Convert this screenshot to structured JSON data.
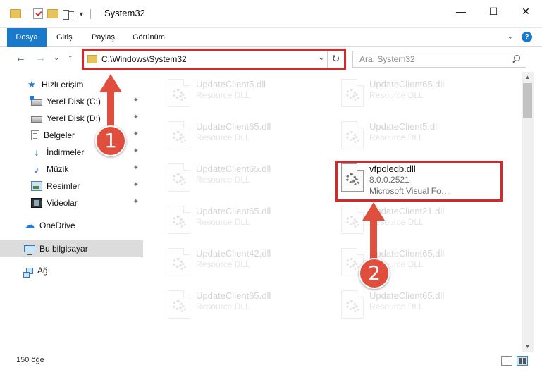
{
  "window": {
    "title": "System32",
    "controls": {
      "minimize": "—",
      "maximize": "☐",
      "close": "✕"
    }
  },
  "ribbon": {
    "tabs": [
      "Dosya",
      "Giriş",
      "Paylaş",
      "Görünüm"
    ],
    "expand": "⌄",
    "help": "?"
  },
  "nav": {
    "back": "←",
    "forward": "→",
    "recent": "⌄",
    "up": "↑",
    "address": "C:\\Windows\\System32",
    "address_dropdown": "⌄",
    "refresh": "↻",
    "search_placeholder": "Ara: System32"
  },
  "sidebar": {
    "items": [
      {
        "label": "Hızlı erişim",
        "icon": "star-icon",
        "pinned": false
      },
      {
        "label": "Yerel Disk (C:)",
        "icon": "drive-icon",
        "pinned": true
      },
      {
        "label": "Yerel Disk (D:)",
        "icon": "drive-icon",
        "pinned": true
      },
      {
        "label": "Belgeler",
        "icon": "documents-icon",
        "pinned": true
      },
      {
        "label": "İndirmeler",
        "icon": "download-icon",
        "pinned": true
      },
      {
        "label": "Müzik",
        "icon": "music-icon",
        "pinned": true
      },
      {
        "label": "Resimler",
        "icon": "pictures-icon",
        "pinned": true
      },
      {
        "label": "Videolar",
        "icon": "videos-icon",
        "pinned": true
      },
      {
        "label": "OneDrive",
        "icon": "cloud-icon",
        "pinned": false
      },
      {
        "label": "Bu bilgisayar",
        "icon": "computer-icon",
        "pinned": false,
        "selected": true
      },
      {
        "label": "Ağ",
        "icon": "network-icon",
        "pinned": false
      }
    ],
    "pin_glyph": "📌"
  },
  "files": [
    {
      "name": "UpdateClient5.dll",
      "type": "Resource DLL",
      "faded": true
    },
    {
      "name": "UpdateClient65.dll",
      "type": "Resource DLL",
      "faded": true
    },
    {
      "name": "UpdateClient65.dll",
      "type": "Resource DLL",
      "faded": true
    },
    {
      "name": "UpdateClient5.dll",
      "type": "Resource DLL",
      "faded": true
    },
    {
      "name": "UpdateClient65.dll",
      "type": "Resource DLL",
      "faded": true
    },
    {
      "name": "vfpoledb.dll",
      "version": "8.0.0.2521",
      "type": "Microsoft Visual Fo…",
      "faded": false,
      "highlighted": true
    },
    {
      "name": "UpdateClient65.dll",
      "type": "Resource DLL",
      "faded": true
    },
    {
      "name": "UpdateClient21.dll",
      "type": "Resource DLL",
      "faded": true
    },
    {
      "name": "UpdateClient42.dll",
      "type": "Resource DLL",
      "faded": true
    },
    {
      "name": "UpdateClient65.dll",
      "type": "Resource DLL",
      "faded": true
    },
    {
      "name": "UpdateClient65.dll",
      "type": "Resource DLL",
      "faded": true
    },
    {
      "name": "UpdateClient65.dll",
      "type": "Resource DLL",
      "faded": true
    }
  ],
  "status": {
    "count": "150 öğe"
  },
  "annotations": {
    "badge1": "1",
    "badge2": "2",
    "color": "#e04e3e"
  },
  "colors": {
    "accent": "#1979ca",
    "highlight_border": "#d92626"
  }
}
